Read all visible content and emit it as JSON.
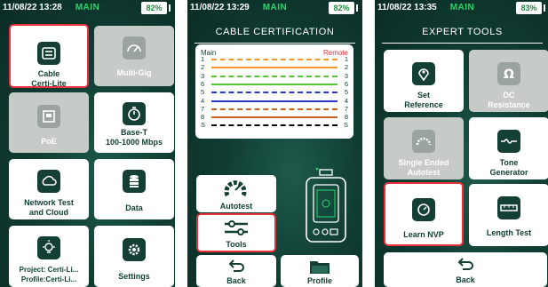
{
  "screens": [
    {
      "status": {
        "time": "11/08/22 13:28",
        "mode": "MAIN",
        "battery": "82%"
      },
      "tiles": [
        {
          "label": "Cable\nCerti-Lite",
          "icon": "cable-icon",
          "state": "selected"
        },
        {
          "label": "Multi-Gig",
          "icon": "speedometer-icon",
          "state": "disabled"
        },
        {
          "label": "PoE",
          "icon": "poe-port-icon",
          "state": "disabled"
        },
        {
          "label": "Base-T\n100-1000 Mbps",
          "icon": "stopwatch-icon",
          "state": "normal"
        },
        {
          "label": "Network Test\nand Cloud",
          "icon": "cloud-network-icon",
          "state": "normal"
        },
        {
          "label": "Data",
          "icon": "database-icon",
          "state": "normal"
        },
        {
          "label": "Project: Certi-Li...\nProfile:Certi-Li...",
          "icon": "lightbulb-icon",
          "state": "normal"
        },
        {
          "label": "Settings",
          "icon": "gear-icon",
          "state": "normal"
        }
      ]
    },
    {
      "status": {
        "time": "11/08/22 13:29",
        "mode": "MAIN",
        "battery": "82%"
      },
      "title": "CABLE CERTIFICATION",
      "cable": {
        "main_label": "Main",
        "remote_label": "Remote",
        "wires": [
          {
            "pin": "1",
            "color": "#f39a2b",
            "dashed": true
          },
          {
            "pin": "2",
            "color": "#f39a2b",
            "dashed": false
          },
          {
            "pin": "3",
            "color": "#55c53a",
            "dashed": true
          },
          {
            "pin": "6",
            "color": "#55c53a",
            "dashed": false
          },
          {
            "pin": "5",
            "color": "#2d39c9",
            "dashed": true
          },
          {
            "pin": "4",
            "color": "#2d39c9",
            "dashed": false
          },
          {
            "pin": "7",
            "color": "#c9641e",
            "dashed": true
          },
          {
            "pin": "8",
            "color": "#c9641e",
            "dashed": false
          },
          {
            "pin": "S",
            "color": "#000000",
            "dashed": true
          }
        ]
      },
      "buttons": [
        {
          "label": "Autotest",
          "icon": "autotest-gauge-icon",
          "state": "normal"
        },
        {
          "label": "Tools",
          "icon": "tools-icon",
          "state": "selected"
        },
        {
          "label": "Back",
          "icon": "back-arrow-icon",
          "state": "normal"
        },
        {
          "label": "Profile",
          "icon": "folder-icon",
          "state": "normal"
        }
      ]
    },
    {
      "status": {
        "time": "11/08/22 13:35",
        "mode": "MAIN",
        "battery": "83%"
      },
      "title": "EXPERT TOOLS",
      "tiles": [
        {
          "label": "Set\nReference",
          "icon": "location-pin-icon",
          "state": "normal"
        },
        {
          "label": "DC\nResistance",
          "icon": "ohm-icon",
          "state": "disabled"
        },
        {
          "label": "Single Ended\nAutotest",
          "icon": "gauge-icon",
          "state": "disabled"
        },
        {
          "label": "Tone\nGenerator",
          "icon": "tone-wave-icon",
          "state": "normal"
        },
        {
          "label": "Learn NVP",
          "icon": "nvp-dial-icon",
          "state": "selected"
        },
        {
          "label": "Length Test",
          "icon": "ruler-icon",
          "state": "normal"
        },
        {
          "label": "Back",
          "icon": "back-arrow-icon",
          "state": "normal"
        }
      ]
    }
  ],
  "colors": {
    "background": "#103d33",
    "accent_green": "#2bd46b",
    "selected_border": "#e8313b",
    "tile": "#ffffff",
    "tile_disabled": "#c6cbc8"
  }
}
